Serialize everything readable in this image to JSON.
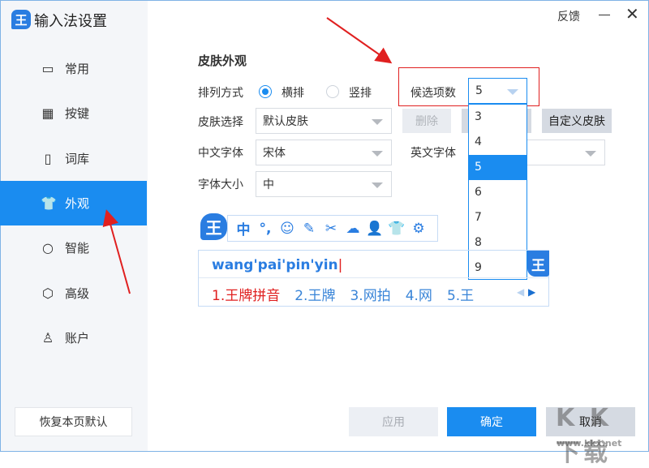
{
  "app": {
    "logo": "王",
    "title": "输入法设置",
    "feedback": "反馈"
  },
  "sidebar": {
    "items": [
      {
        "icon": "monitor-icon",
        "glyph": "▭",
        "label": "常用"
      },
      {
        "icon": "keyboard-icon",
        "glyph": "▦",
        "label": "按键"
      },
      {
        "icon": "book-icon",
        "glyph": "▯",
        "label": "词库"
      },
      {
        "icon": "shirt-icon",
        "glyph": "👕",
        "label": "外观"
      },
      {
        "icon": "search-icon",
        "glyph": "○",
        "label": "智能"
      },
      {
        "icon": "hexagon-icon",
        "glyph": "⬡",
        "label": "高级"
      },
      {
        "icon": "user-icon",
        "glyph": "♙",
        "label": "账户"
      }
    ],
    "active": 3,
    "restore": "恢复本页默认"
  },
  "section": {
    "title": "皮肤外观",
    "layout": {
      "label": "排列方式",
      "options": [
        "横排",
        "竖排"
      ],
      "selected": "横排"
    },
    "candidates": {
      "label": "候选项数",
      "value": "5",
      "options": [
        "3",
        "4",
        "5",
        "6",
        "7",
        "8",
        "9"
      ]
    },
    "skin": {
      "label": "皮肤选择",
      "value": "默认皮肤",
      "delete": "删除",
      "custom": "自定义皮肤"
    },
    "cnfont": {
      "label": "中文字体",
      "value": "宋体"
    },
    "enfont": {
      "label": "英文字体",
      "value": ""
    },
    "size": {
      "label": "字体大小",
      "value": "中"
    }
  },
  "preview": {
    "logo": "王",
    "toolbar": [
      "中",
      "°,",
      "☺",
      "✎",
      "✂",
      "☁",
      "👤",
      "👕",
      "⚙"
    ],
    "input": "wang'pai'pin'yin",
    "candidates": [
      "1.王牌拼音",
      "2.王牌",
      "3.网拍",
      "4.网",
      "5.王"
    ]
  },
  "footer": {
    "apply": "应用",
    "ok": "确定",
    "cancel": "取消"
  },
  "watermark": {
    "text": "KK下载",
    "url": "www.kkx.net"
  },
  "colors": {
    "accent": "#1a8cf0",
    "annotation": "#e02020"
  }
}
